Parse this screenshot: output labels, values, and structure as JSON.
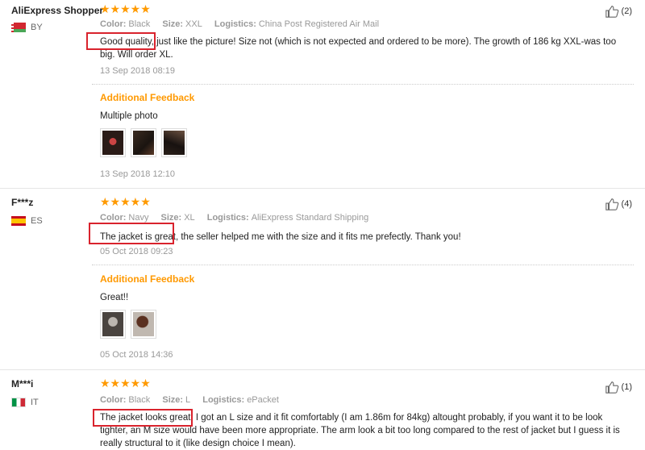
{
  "reviews": [
    {
      "user": "AliExpress Shopper",
      "country": "BY",
      "stars": "★★★★★",
      "color_label": "Color:",
      "color": "Black",
      "size_label": "Size:",
      "size": "XXL",
      "logistics_label": "Logistics:",
      "logistics": "China Post Registered Air Mail",
      "text_line1": "Good quality, just like the picture! Size not (which is not expected and ordered to be more). The growth of 186 kg XXL-was too",
      "text_line2": "big. Will order XL.",
      "date": "13 Sep 2018 08:19",
      "additional_title": "Additional Feedback",
      "additional_text": "Multiple photo",
      "additional_date": "13 Sep 2018 12:10",
      "likes": "(2)"
    },
    {
      "user": "F***z",
      "country": "ES",
      "stars": "★★★★★",
      "color_label": "Color:",
      "color": "Navy",
      "size_label": "Size:",
      "size": "XL",
      "logistics_label": "Logistics:",
      "logistics": "AliExpress Standard Shipping",
      "text_line1": "The jacket is great, the seller helped me with the size and it fits me prefectly. Thank you!",
      "date": "05 Oct 2018 09:23",
      "additional_title": "Additional Feedback",
      "additional_text": "Great!!",
      "additional_date": "05 Oct 2018 14:36",
      "likes": "(4)"
    },
    {
      "user": "M***i",
      "country": "IT",
      "stars": "★★★★★",
      "color_label": "Color:",
      "color": "Black",
      "size_label": "Size:",
      "size": "L",
      "logistics_label": "Logistics:",
      "logistics": "ePacket",
      "text_line1": "The jacket looks great, I got an L size and it fit comfortably (I am 1.86m for 84kg) altought probably, if you want it to be look",
      "text_line2": "tighter, an M size would have been more appropriate. The arm look a bit too long compared to the rest of jacket but I guess it is",
      "text_line3": "really structural to it (like design choice I mean).",
      "likes": "(1)"
    }
  ],
  "colors": {
    "star": "#ff9a00",
    "feedback_title": "#ff9900",
    "highlight": "#d9232d"
  }
}
